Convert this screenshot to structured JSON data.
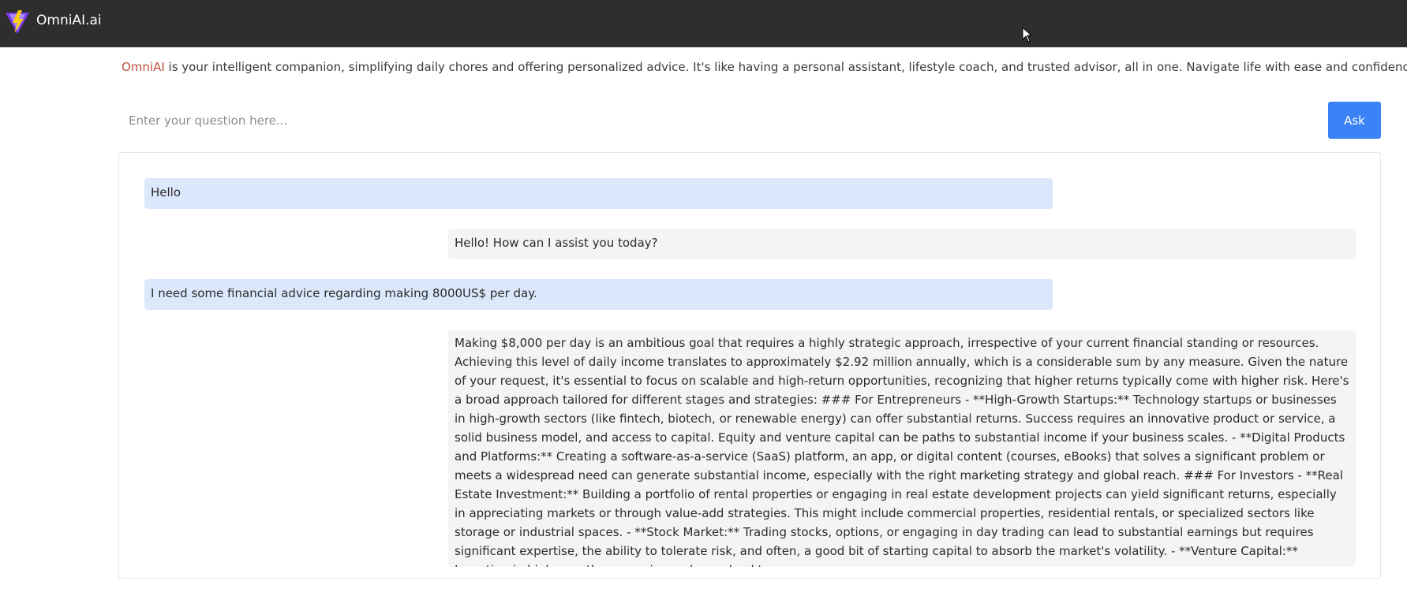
{
  "header": {
    "brand": "OmniAI.ai",
    "logo_icon": "omniai-lightning-logo-icon",
    "colors": {
      "bar": "#2e2e2e",
      "logo_purple": "#7c3aed",
      "logo_bolt": "#facc15"
    }
  },
  "intro": {
    "brand": "OmniAI",
    "text": " is your intelligent companion, simplifying daily chores and offering personalized advice. It's like having a personal assistant, lifestyle coach, and trusted advisor, all in one. Navigate life with ease and confidence."
  },
  "ask": {
    "placeholder": "Enter your question here...",
    "value": "",
    "button_label": "Ask",
    "button_color": "#3b82f6"
  },
  "chat": {
    "messages": [
      {
        "role": "user",
        "text": "Hello"
      },
      {
        "role": "assistant",
        "text": "Hello! How can I assist you today?"
      },
      {
        "role": "user",
        "text": "I need some financial advice regarding making 8000US$ per day."
      },
      {
        "role": "assistant",
        "text": "Making $8,000 per day is an ambitious goal that requires a highly strategic approach, irrespective of your current financial standing or resources. Achieving this level of daily income translates to approximately $2.92 million annually, which is a considerable sum by any measure. Given the nature of your request, it's essential to focus on scalable and high-return opportunities, recognizing that higher returns typically come with higher risk. Here's a broad approach tailored for different stages and strategies: ### For Entrepreneurs - **High-Growth Startups:** Technology startups or businesses in high-growth sectors (like fintech, biotech, or renewable energy) can offer substantial returns. Success requires an innovative product or service, a solid business model, and access to capital. Equity and venture capital can be paths to substantial income if your business scales. - **Digital Products and Platforms:** Creating a software-as-a-service (SaaS) platform, an app, or digital content (courses, eBooks) that solves a significant problem or meets a widespread need can generate substantial income, especially with the right marketing strategy and global reach. ### For Investors - **Real Estate Investment:** Building a portfolio of rental properties or engaging in real estate development projects can yield significant returns, especially in appreciating markets or through value-add strategies. This might include commercial properties, residential rentals, or specialized sectors like storage or industrial spaces. - **Stock Market:** Trading stocks, options, or engaging in day trading can lead to substantial earnings but requires significant expertise, the ability to tolerate risk, and often, a good bit of starting capital to absorb the market's volatility. - **Venture Capital:** Investing in high-growth companies early can lead to"
      }
    ],
    "colors": {
      "user_bubble": "#dbe8fb",
      "assistant_bubble": "#f3f4f6"
    }
  }
}
